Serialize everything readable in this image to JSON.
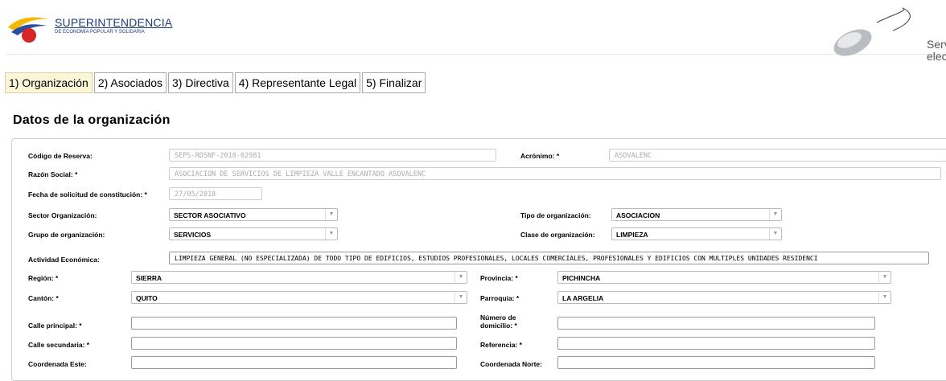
{
  "header": {
    "logo_title": "SUPERINTENDENCIA",
    "logo_subtitle": "DE ECONOMÍA POPULAR Y SOLIDARIA",
    "right_text_1": "Serv",
    "right_text_2": "electró"
  },
  "tabs": [
    {
      "label": "1) Organización",
      "active": true
    },
    {
      "label": "2) Asociados"
    },
    {
      "label": "3) Directiva"
    },
    {
      "label": "4) Representante Legal"
    },
    {
      "label": "5) Finalizar"
    }
  ],
  "page_title": "Datos de la organización",
  "form": {
    "codigo_reserva": {
      "label": "Código de Reserva:",
      "value": "SEPS-RDSNF-2018-02981"
    },
    "acronimo": {
      "label": "Acrónimo: *",
      "value": "ASOVALENC"
    },
    "razon_social": {
      "label": "Razón Social: *",
      "value": "ASOCIACION DE SERVICIOS DE LIMPIEZA VALLE ENCANTADO  ASOVALENC"
    },
    "fecha_solicitud": {
      "label": "Fecha de solicitud de constitución: *",
      "value": "27/05/2018"
    },
    "sector_organizacion": {
      "label": "Sector Organización:",
      "value": "SECTOR ASOCIATIVO"
    },
    "tipo_organizacion": {
      "label": "Tipo de organización:",
      "value": "ASOCIACION"
    },
    "grupo_organizacion": {
      "label": "Grupo de organización:",
      "value": "SERVICIOS"
    },
    "clase_organizacion": {
      "label": "Clase de organización:",
      "value": "LIMPIEZA"
    },
    "actividad_economica": {
      "label": "Actividad Económica:",
      "value": "LIMPIEZA GENERAL (NO ESPECIALIZADA) DE TODO TIPO DE EDIFICIOS, ESTUDIOS PROFESIONALES, LOCALES COMERCIALES,  PROFESIONALES Y EDIFICIOS CON MULTIPLES UNIDADES RESIDENCI"
    },
    "region": {
      "label": "Región: *",
      "value": "SIERRA"
    },
    "provincia": {
      "label": "Provincia: *",
      "value": "PICHINCHA"
    },
    "canton": {
      "label": "Cantón: *",
      "value": "QUITO"
    },
    "parroquia": {
      "label": "Parroquia: *",
      "value": "LA ARGELIA"
    },
    "calle_principal": {
      "label": "Calle principal: *",
      "value": ""
    },
    "numero_domicilio": {
      "label": "Número de domicilio: *",
      "value": ""
    },
    "calle_secundaria": {
      "label": "Calle secundaria: *",
      "value": ""
    },
    "referencia": {
      "label": "Referencia: *",
      "value": ""
    },
    "coordenada_este": {
      "label": "Coordenada Este:",
      "value": ""
    },
    "coordenada_norte": {
      "label": "Coordenada Norte:",
      "value": ""
    }
  },
  "dropdown_arrow": "▼"
}
